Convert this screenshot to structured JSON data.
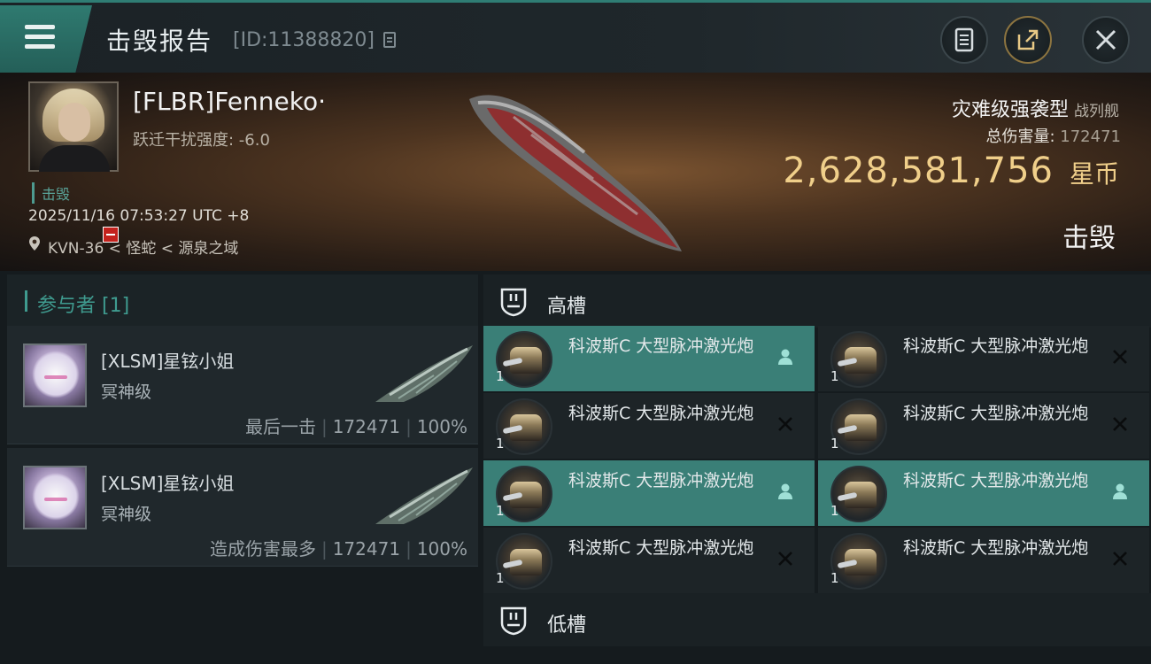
{
  "header": {
    "title": "击毁报告",
    "report_id": "[ID:11388820]"
  },
  "victim": {
    "name": "[FLBR]Fenneko·",
    "jam_strength": "跃迁干扰强度: -6.0",
    "kill_tag": "击毁",
    "timestamp": "2025/11/16 07:53:27 UTC +8",
    "location": "KVN-36 < 怪蛇 < 源泉之域",
    "ship_name": "灾难级强袭型",
    "ship_class": "战列舰",
    "damage_label": "总伤害量:",
    "damage_value": "172471",
    "isk_value": "2,628,581,756",
    "isk_unit": "星币",
    "status": "击毁"
  },
  "participants": {
    "header": "参与者 [1]",
    "items": [
      {
        "name": "[XLSM]星铉小姐",
        "ship": "冥神级",
        "role": "最后一击",
        "damage": "172471",
        "percent": "100%"
      },
      {
        "name": "[XLSM]星铉小姐",
        "ship": "冥神级",
        "role": "造成伤害最多",
        "damage": "172471",
        "percent": "100%"
      }
    ]
  },
  "slots": {
    "high_label": "高槽",
    "low_label": "低槽",
    "high_modules": [
      {
        "name": "科波斯C 大型脉冲激光炮",
        "qty": "1",
        "status": "dropped",
        "highlight": true
      },
      {
        "name": "科波斯C 大型脉冲激光炮",
        "qty": "1",
        "status": "destroyed",
        "highlight": false
      },
      {
        "name": "科波斯C 大型脉冲激光炮",
        "qty": "1",
        "status": "destroyed",
        "highlight": false
      },
      {
        "name": "科波斯C 大型脉冲激光炮",
        "qty": "1",
        "status": "destroyed",
        "highlight": false
      },
      {
        "name": "科波斯C 大型脉冲激光炮",
        "qty": "1",
        "status": "dropped",
        "highlight": true
      },
      {
        "name": "科波斯C 大型脉冲激光炮",
        "qty": "1",
        "status": "dropped",
        "highlight": true
      },
      {
        "name": "科波斯C 大型脉冲激光炮",
        "qty": "1",
        "status": "destroyed",
        "highlight": false
      },
      {
        "name": "科波斯C 大型脉冲激光炮",
        "qty": "1",
        "status": "destroyed",
        "highlight": false
      }
    ]
  },
  "icons": {
    "menu": "menu-icon",
    "copy": "copy-icon",
    "notes": "document-icon",
    "share": "share-icon",
    "close": "close-icon",
    "location": "map-pin-icon",
    "slot": "shield-slot-icon",
    "dropped": "person-icon",
    "destroyed": "x-icon"
  },
  "colors": {
    "accent": "#3a7f77",
    "isk": "#f0cf8a",
    "victim_badge": "#c4221d"
  }
}
